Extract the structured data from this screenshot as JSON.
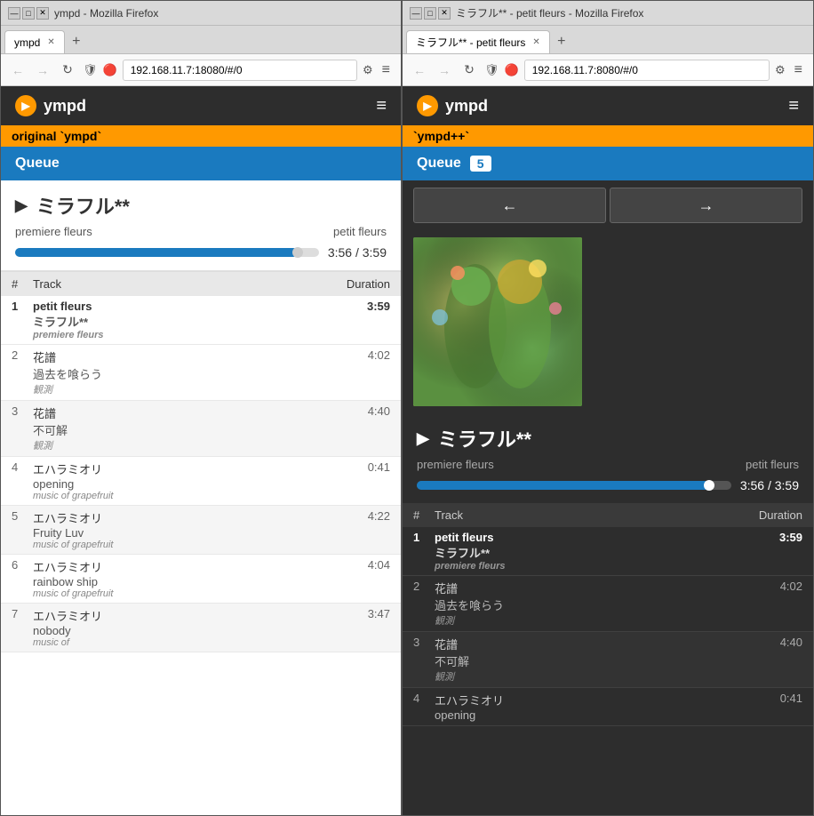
{
  "left_window": {
    "title_bar": {
      "title": "ympd - Mozilla Firefox",
      "buttons": [
        "—",
        "□",
        "✕"
      ]
    },
    "tab": {
      "label": "ympd",
      "close": "✕"
    },
    "address": "192.168.11.7:18080/#/0",
    "app_title": "ympd",
    "version_badge": "original `ympd`",
    "queue_label": "Queue",
    "now_playing": {
      "title": "ミラフル**",
      "artist": "premiere fleurs",
      "album": "petit fleurs",
      "time": "3:56 / 3:59",
      "progress_pct": 93
    },
    "table": {
      "headers": [
        "#",
        "Track",
        "Duration"
      ],
      "rows": [
        {
          "num": "1",
          "name": "petit fleurs",
          "track": "ミラフル**",
          "artist": "premiere fleurs",
          "duration": "3:59",
          "active": true
        },
        {
          "num": "2",
          "name": "花譜",
          "track": "過去を喰らう",
          "artist": "観測",
          "duration": "4:02",
          "active": false
        },
        {
          "num": "3",
          "name": "花譜",
          "track": "不可解",
          "artist": "観測",
          "duration": "4:40",
          "active": false
        },
        {
          "num": "4",
          "name": "エハラミオリ",
          "track": "opening",
          "artist": "music of grapefruit",
          "duration": "0:41",
          "active": false
        },
        {
          "num": "5",
          "name": "エハラミオリ",
          "track": "Fruity Luv",
          "artist": "music of grapefruit",
          "duration": "4:22",
          "active": false
        },
        {
          "num": "6",
          "name": "エハラミオリ",
          "track": "rainbow ship",
          "artist": "music of grapefruit",
          "duration": "4:04",
          "active": false
        },
        {
          "num": "7",
          "name": "エハラミオリ",
          "track": "nobody",
          "artist": "music of",
          "duration": "3:47",
          "active": false
        }
      ]
    }
  },
  "right_window": {
    "title_bar": {
      "title": "ミラフル** - petit fleurs - Mozilla Firefox",
      "buttons": [
        "—",
        "□",
        "✕"
      ]
    },
    "tab": {
      "label": "ミラフル** - petit fleurs",
      "close": "✕"
    },
    "address": "192.168.11.7:8080/#/0",
    "app_title": "ympd",
    "version_badge": "`ympd++`",
    "queue_label": "Queue",
    "queue_count": "5",
    "nav_prev": "←",
    "nav_next": "→",
    "now_playing": {
      "title": "ミラフル**",
      "artist": "premiere fleurs",
      "album": "petit fleurs",
      "time": "3:56 / 3:59",
      "progress_pct": 93
    },
    "table": {
      "headers": [
        "#",
        "Track",
        "Duration"
      ],
      "rows": [
        {
          "num": "1",
          "name": "petit fleurs",
          "track": "ミラフル**",
          "artist": "premiere fleurs",
          "duration": "3:59",
          "active": true
        },
        {
          "num": "2",
          "name": "花譜",
          "track": "過去を喰らう",
          "artist": "観測",
          "duration": "4:02",
          "active": false
        },
        {
          "num": "3",
          "name": "花譜",
          "track": "不可解",
          "artist": "観測",
          "duration": "4:40",
          "active": false
        },
        {
          "num": "4",
          "name": "エハラミオリ",
          "track": "opening",
          "artist": "",
          "duration": "0:41",
          "active": false
        }
      ]
    }
  }
}
